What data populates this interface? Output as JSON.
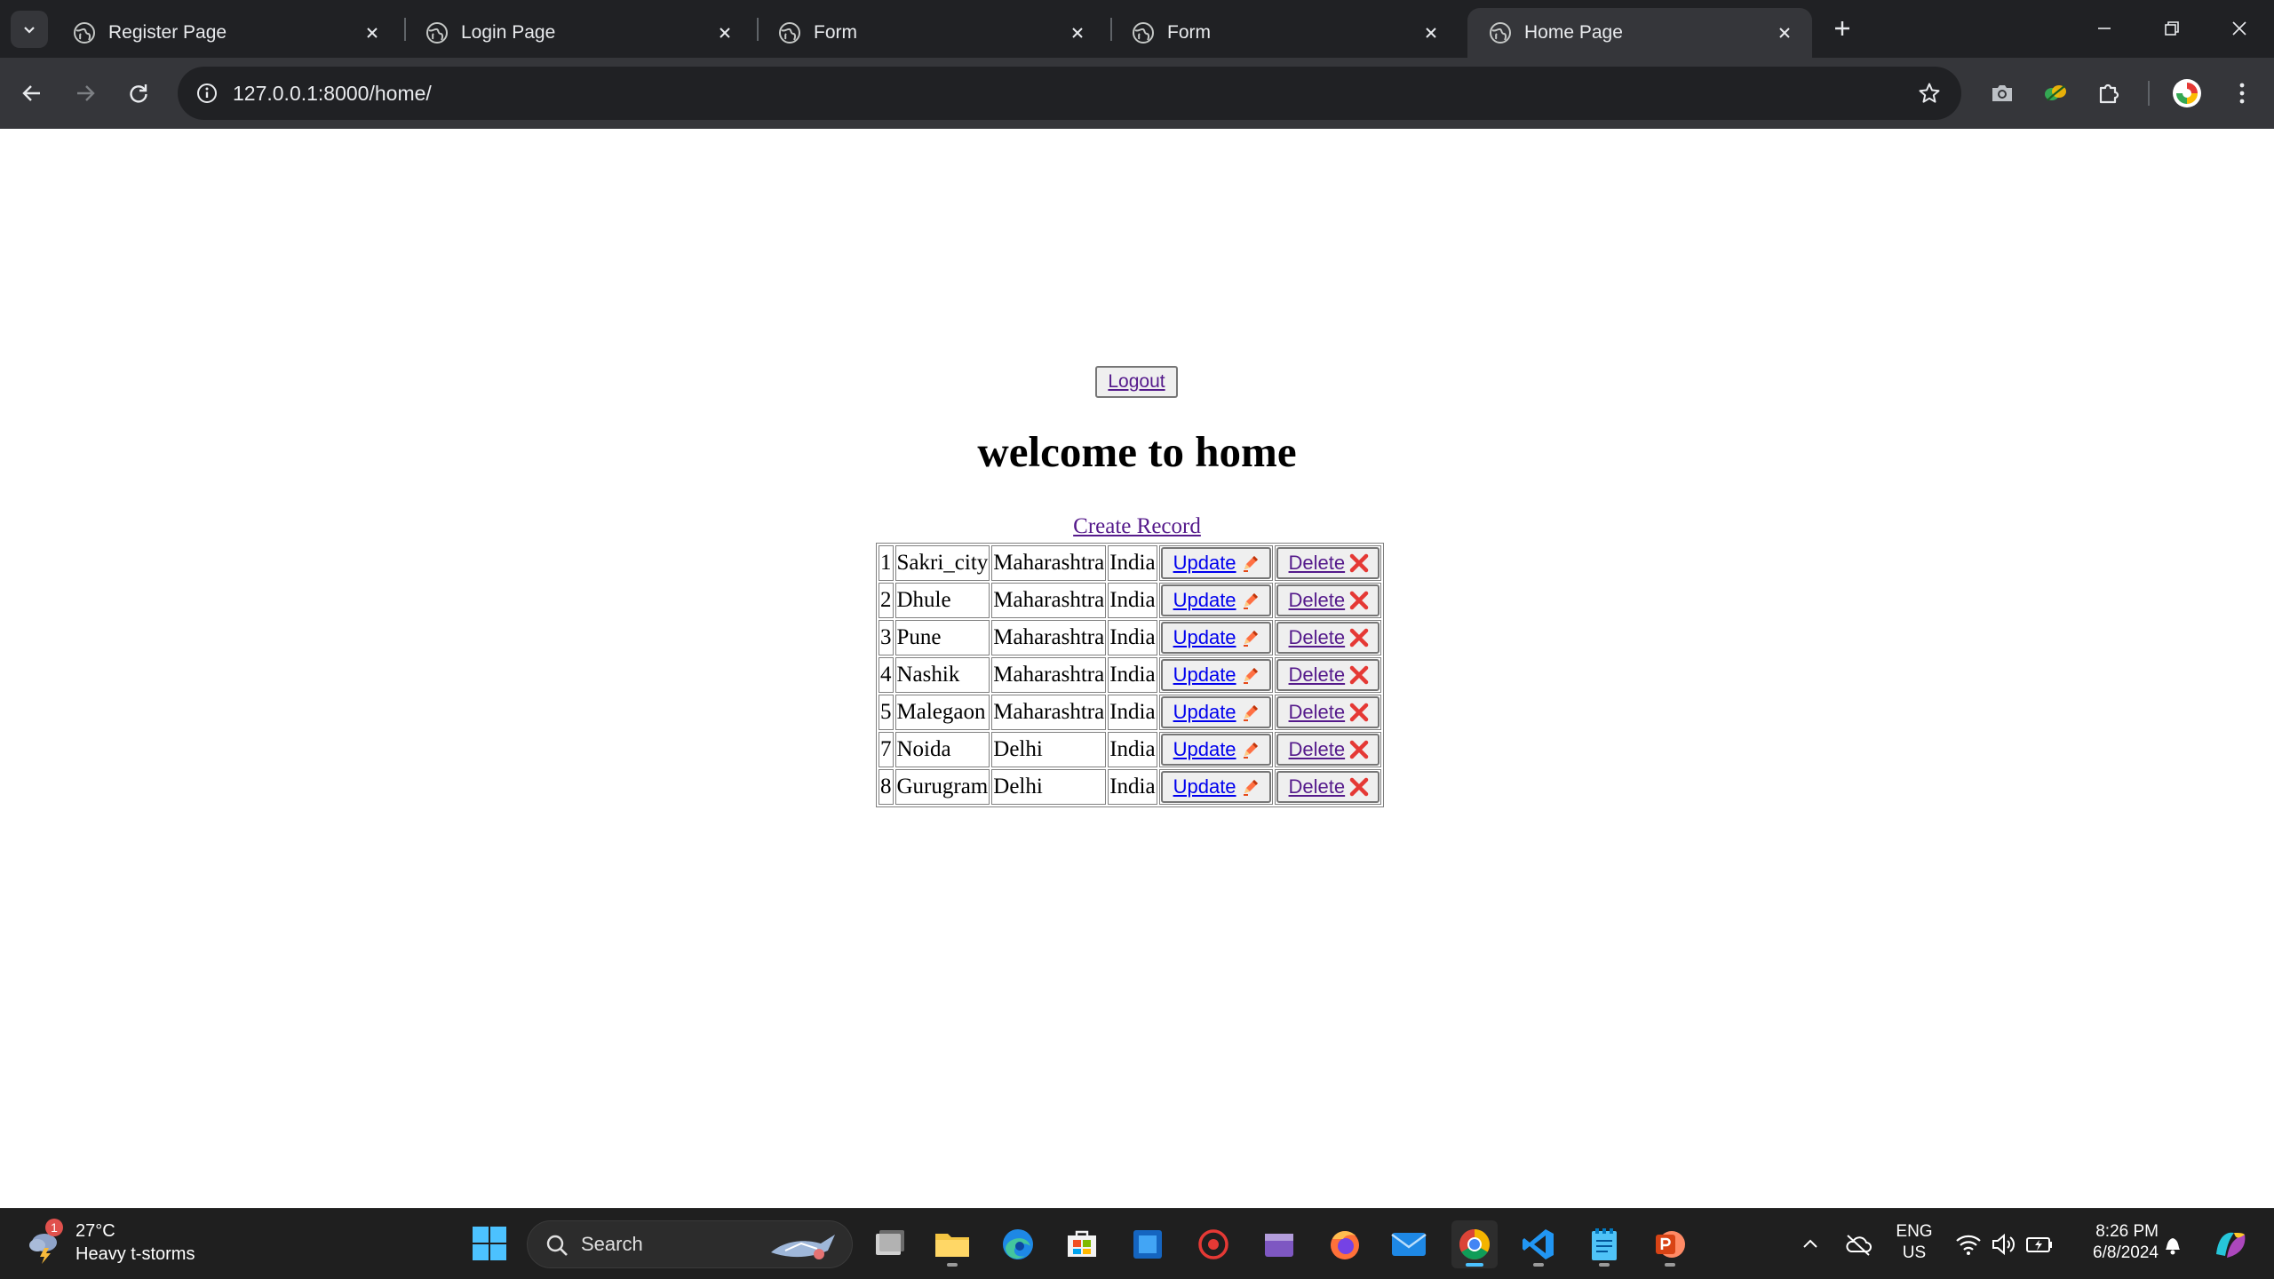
{
  "browser": {
    "tabs": [
      {
        "title": "Register Page",
        "active": false
      },
      {
        "title": "Login Page",
        "active": false
      },
      {
        "title": "Form",
        "active": false
      },
      {
        "title": "Form",
        "active": false
      },
      {
        "title": "Home Page",
        "active": true
      }
    ],
    "url": "127.0.0.1:8000/home/"
  },
  "page": {
    "logout_label": "Logout",
    "title": "welcome to home",
    "create_label": "Create Record",
    "update_label": "Update",
    "delete_label": "Delete",
    "rows": [
      {
        "id": "1",
        "city": "Sakri_city",
        "state": "Maharashtra",
        "country": "India"
      },
      {
        "id": "2",
        "city": "Dhule",
        "state": "Maharashtra",
        "country": "India"
      },
      {
        "id": "3",
        "city": "Pune",
        "state": "Maharashtra",
        "country": "India"
      },
      {
        "id": "4",
        "city": "Nashik",
        "state": "Maharashtra",
        "country": "India"
      },
      {
        "id": "5",
        "city": "Malegaon",
        "state": "Maharashtra",
        "country": "India"
      },
      {
        "id": "7",
        "city": "Noida",
        "state": "Delhi",
        "country": "India"
      },
      {
        "id": "8",
        "city": "Gurugram",
        "state": "Delhi",
        "country": "India"
      }
    ]
  },
  "taskbar": {
    "weather_temp": "27°C",
    "weather_condition": "Heavy t-storms",
    "weather_badge": "1",
    "search_label": "Search",
    "lang_line1": "ENG",
    "lang_line2": "US",
    "time": "8:26 PM",
    "date": "6/8/2024"
  },
  "colors": {
    "link_visited": "#551a8b",
    "link_unvisited": "#0000ee",
    "delete_icon": "#e53935",
    "update_icon": "#ff7043",
    "chrome_dark": "#202124",
    "chrome_toolbar": "#35363a"
  }
}
